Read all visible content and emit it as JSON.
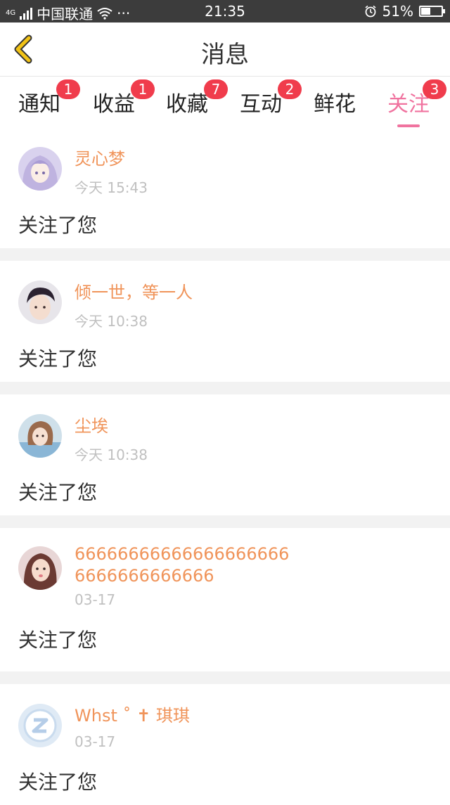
{
  "status_bar": {
    "network": "4G",
    "carrier": "中国联通",
    "dots": "···",
    "time": "21:35",
    "battery_pct_text": "51%",
    "battery_level": 0.51
  },
  "header": {
    "title": "消息"
  },
  "tabs": [
    {
      "label": "通知",
      "badge": "1"
    },
    {
      "label": "收益",
      "badge": "1"
    },
    {
      "label": "收藏",
      "badge": "7"
    },
    {
      "label": "互动",
      "badge": "2"
    },
    {
      "label": "鲜花",
      "badge": ""
    },
    {
      "label": "关注",
      "badge": "3",
      "active": true
    }
  ],
  "items": [
    {
      "name": "灵心梦",
      "time": "今天 15:43",
      "action": "关注了您",
      "avatar": "anime-girl-avatar"
    },
    {
      "name": "倾一世，等一人",
      "time": "今天 10:38",
      "action": "关注了您",
      "avatar": "boy-avatar"
    },
    {
      "name": "尘埃",
      "time": "今天 10:38",
      "action": "关注了您",
      "avatar": "girl-avatar"
    },
    {
      "name": "66666666666666666666",
      "name_line2": "6666666666666",
      "time": "03-17",
      "action": "关注了您",
      "avatar": "girl-avatar"
    },
    {
      "name": "Whst ˚ ✝ 琪琪",
      "time": "03-17",
      "action": "关注了您",
      "avatar": "default-avatar"
    }
  ],
  "colors": {
    "accent": "#f0739f",
    "name": "#f0945a",
    "badge": "#f03c4c",
    "back_arrow": "#f2c316"
  }
}
